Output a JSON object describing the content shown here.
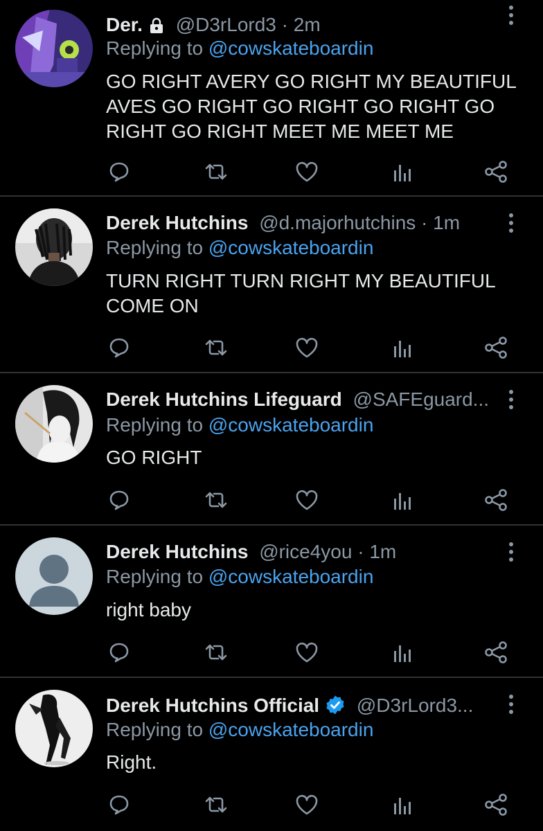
{
  "tweets": [
    {
      "name": "Der.",
      "handle": "@D3rLord3",
      "time": "· 2m",
      "reply_prefix": "Replying to ",
      "reply_to": "@cowskateboardin",
      "text": "GO RIGHT AVERY GO RIGHT MY BEAUTIFUL AVES GO RIGHT GO RIGHT GO RIGHT GO RIGHT GO RIGHT MEET ME MEET ME",
      "protected": true
    },
    {
      "name": "Derek Hutchins",
      "handle": "@d.majorhutchins",
      "time": "· 1m",
      "reply_prefix": "Replying to ",
      "reply_to": "@cowskateboardin",
      "text": "TURN RIGHT TURN RIGHT MY BEAUTIFUL COME ON"
    },
    {
      "name": "Derek Hutchins Lifeguard",
      "handle": "@SAFEguard...",
      "time": "",
      "reply_prefix": "Replying to ",
      "reply_to": "@cowskateboardin",
      "text": "GO RIGHT"
    },
    {
      "name": "Derek Hutchins",
      "handle": "@rice4you",
      "time": "· 1m",
      "reply_prefix": "Replying to ",
      "reply_to": "@cowskateboardin",
      "text": "right baby"
    },
    {
      "name": "Derek Hutchins Official",
      "handle": "@D3rLord3...",
      "time": "",
      "reply_prefix": "Replying to ",
      "reply_to": "@cowskateboardin",
      "text": "Right.",
      "verified": true
    }
  ],
  "icons": {
    "reply": "reply-icon",
    "retweet": "retweet-icon",
    "like": "like-icon",
    "analytics": "analytics-icon",
    "share": "share-icon",
    "more": "more-icon",
    "lock": "lock-icon",
    "verified": "verified-badge-icon"
  },
  "colors": {
    "background": "#000000",
    "text": "#e7e9ea",
    "secondary": "#8b98a5",
    "link": "#4aa3ef",
    "divider": "#2f3336",
    "verified": "#1d9bf0"
  }
}
